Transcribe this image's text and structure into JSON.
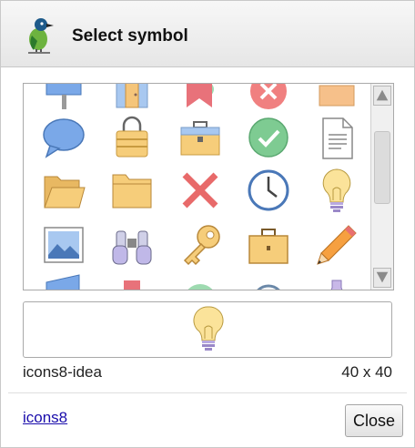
{
  "dialog": {
    "title": "Select symbol",
    "close_label": "Close",
    "link_label": "icons8"
  },
  "selected": {
    "name": "icons8-idea",
    "size": "40 x 40"
  },
  "gallery": {
    "rows": [
      [
        "sign-icon",
        "door-icon",
        "bookmark-icon",
        "cancel-icon",
        "box-icon"
      ],
      [
        "speech-bubble-icon",
        "shopping-bag-icon",
        "toolbox-icon",
        "checkmark-icon",
        "document-icon"
      ],
      [
        "open-folder-icon",
        "folder-icon",
        "x-mark-icon",
        "clock-icon",
        "lightbulb-icon"
      ],
      [
        "landscape-picture-icon",
        "binoculars-icon",
        "key-icon",
        "briefcase-icon",
        "pencil-icon"
      ],
      [
        "book-icon",
        "card-icon",
        "circle-icon",
        "magnifier-icon",
        "flask-icon"
      ]
    ],
    "scroll_position": 0.35
  },
  "colors": {
    "accent_blue": "#7aa8e8",
    "folder_yellow": "#f6cd7a",
    "green_check": "#7ecb92",
    "red_cross": "#f06c6c"
  }
}
